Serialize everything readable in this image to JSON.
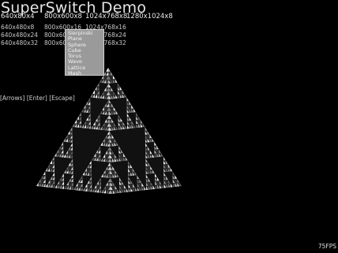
{
  "title": "SuperSwitch Demo",
  "modes": [
    "640x80x4",
    "800x600x8",
    "1024x768x8",
    "1280x1024x8",
    "640x480x8",
    "800x600x16",
    "1024x768x16",
    "640x480x24",
    "800x600x24",
    "1024x768x24",
    "640x480x32",
    "800x600x32",
    "1024x768x32"
  ],
  "popup_menu": {
    "items": [
      "Sierpinski",
      "Plane",
      "Sphere",
      "Cube",
      "Torus",
      "Wave",
      "Lattice",
      "Mesh"
    ]
  },
  "key_hint": "[Arrows] [Enter] [Escape]",
  "fps": "75FPS",
  "colors": {
    "background": "#000000",
    "menu": "#9a9a9a",
    "pyramid": "#c8c8c8"
  }
}
